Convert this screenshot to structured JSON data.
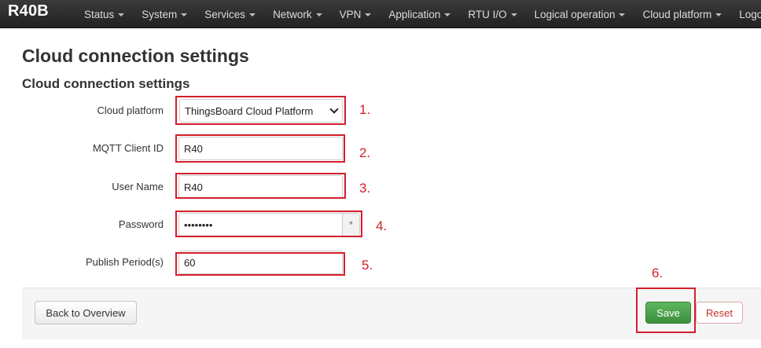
{
  "navbar": {
    "brand": "R40B",
    "items": [
      {
        "label": "Status",
        "dropdown": true
      },
      {
        "label": "System",
        "dropdown": true
      },
      {
        "label": "Services",
        "dropdown": true
      },
      {
        "label": "Network",
        "dropdown": true
      },
      {
        "label": "VPN",
        "dropdown": true
      },
      {
        "label": "Application",
        "dropdown": true
      },
      {
        "label": "RTU I/O",
        "dropdown": true
      },
      {
        "label": "Logical operation",
        "dropdown": true
      },
      {
        "label": "Cloud platform",
        "dropdown": true
      },
      {
        "label": "Logout",
        "dropdown": false
      }
    ]
  },
  "page": {
    "title": "Cloud connection settings",
    "section_title": "Cloud connection settings"
  },
  "form": {
    "cloud_platform": {
      "label": "Cloud platform",
      "value": "ThingsBoard Cloud Platform"
    },
    "mqtt_client_id": {
      "label": "MQTT Client ID",
      "value": "R40"
    },
    "user_name": {
      "label": "User Name",
      "value": "R40"
    },
    "password": {
      "label": "Password",
      "value": "••••••••",
      "reveal_symbol": "*"
    },
    "publish_period": {
      "label": "Publish Period(s)",
      "value": "60"
    }
  },
  "annotations": {
    "n1": "1.",
    "n2": "2.",
    "n3": "3.",
    "n4": "4.",
    "n5": "5.",
    "n6": "6.",
    "color": "#d21f2b"
  },
  "actions": {
    "back_label": "Back to Overview",
    "save_label": "Save",
    "reset_label": "Reset"
  },
  "colors": {
    "navbar": "#222222",
    "save": "#4cae4c",
    "reset_text": "#c9302c"
  }
}
